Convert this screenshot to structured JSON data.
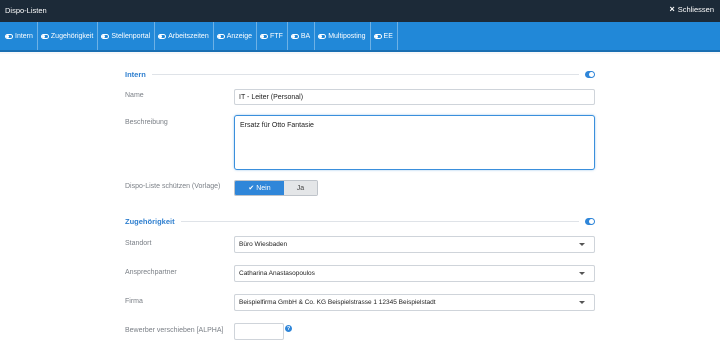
{
  "window": {
    "title": "Dispo-Listen",
    "close_label": "Schliessen"
  },
  "tabs": [
    {
      "label": "Intern"
    },
    {
      "label": "Zugehörigkeit"
    },
    {
      "label": "Stellenportal"
    },
    {
      "label": "Arbeitszeiten"
    },
    {
      "label": "Anzeige"
    },
    {
      "label": "FTF"
    },
    {
      "label": "BA"
    },
    {
      "label": "Multiposting"
    },
    {
      "label": "EE"
    }
  ],
  "sections": {
    "intern": {
      "title": "Intern",
      "name_label": "Name",
      "name_value": "IT - Leiter (Personal)",
      "description_label": "Beschreibung",
      "description_value": "Ersatz für Otto Fantasie",
      "protect_label": "Dispo-Liste schützen (Vorlage)",
      "protect_options": {
        "no": "Nein",
        "yes": "Ja"
      },
      "protect_selected": "Nein"
    },
    "zugehoerigkeit": {
      "title": "Zugehörigkeit",
      "standort_label": "Standort",
      "standort_value": "Büro Wiesbaden",
      "contact_label": "Ansprechpartner",
      "contact_value": "Catharina Anastasopoulos",
      "firma_label": "Firma",
      "firma_value": "Beispielfirma GmbH & Co. KG Beispielstrasse 1 12345 Beispielstadt",
      "shift_label": "Bewerber verschieben [ALPHA]",
      "shift_value": "",
      "help_icon": "?"
    }
  },
  "colors": {
    "accent": "#2f86d9",
    "titlebar": "#1c2a38",
    "tabbar": "#2188d8"
  }
}
